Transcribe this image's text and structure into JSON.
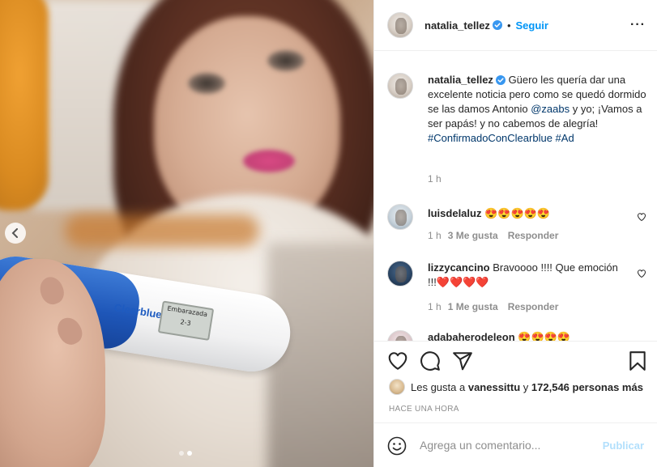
{
  "post": {
    "author": "natalia_tellez",
    "follow_label": "Seguir",
    "separator": "•",
    "more_label": "···",
    "caption": {
      "part1": "Güero les quería dar una excelente noticia pero como se quedó dormido se las damos Antonio ",
      "mention": "@zaabs",
      "part2": " y yo; ¡Vamos a ser papás! y no cabemos de alegría! ",
      "hashtag1": "#ConfirmadoConClearblue",
      "hashtag2": "#Ad",
      "time": "1 h"
    },
    "photo": {
      "brand_text": "Clearblue",
      "window_line1": "Embarazada",
      "window_line2": "2-3",
      "slide_count": 2,
      "active_slide": 2
    }
  },
  "comments": [
    {
      "user": "luisdelaluz",
      "text": "😍😍😍😍😍",
      "time": "1 h",
      "likes": "3 Me gusta",
      "reply": "Responder"
    },
    {
      "user": "lizzycancino",
      "text": "Bravoooo !!!! Que emoción !!!❤️❤️❤️❤️",
      "time": "1 h",
      "likes": "1 Me gusta",
      "reply": "Responder"
    },
    {
      "user": "adabaherodeleon",
      "text": "😍😍😍😍"
    }
  ],
  "likes_row": {
    "prefix": "Les gusta a ",
    "user": "vanessittu",
    "middle": " y ",
    "count": "172,546 personas más"
  },
  "time_ago": "HACE UNA HORA",
  "add_comment": {
    "placeholder": "Agrega un comentario...",
    "publish_label": "Publicar"
  },
  "colors": {
    "link_blue": "#0095f6",
    "mention_blue": "#00376b",
    "muted": "#8e8e8e",
    "publish_disabled": "#b2dffc",
    "verified": "#3897f0"
  }
}
